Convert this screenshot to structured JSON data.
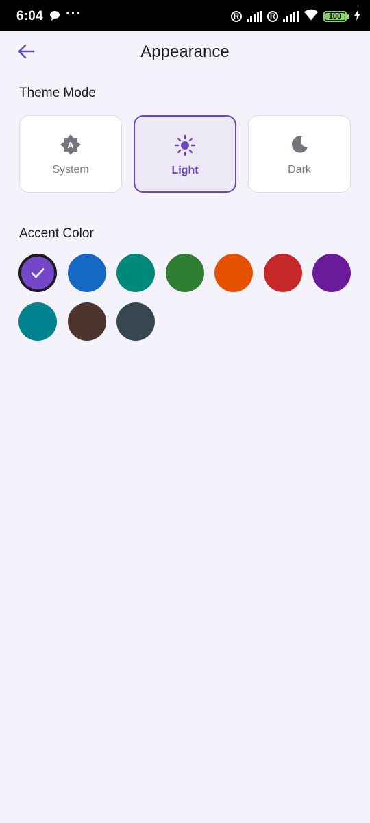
{
  "status_bar": {
    "time": "6:04",
    "dots": "···",
    "reg_symbol": "R",
    "battery": "100"
  },
  "header": {
    "title": "Appearance",
    "back_icon": "arrow-back-icon"
  },
  "theme_mode": {
    "heading": "Theme Mode",
    "options": [
      {
        "label": "System",
        "icon": "brightness-auto-icon",
        "selected": false
      },
      {
        "label": "Light",
        "icon": "sun-icon",
        "selected": true
      },
      {
        "label": "Dark",
        "icon": "moon-icon",
        "selected": false
      }
    ]
  },
  "accent_color": {
    "heading": "Accent Color",
    "selected_index": 0,
    "colors": [
      "#7247c8",
      "#1568c4",
      "#00897b",
      "#2e7d32",
      "#e65100",
      "#c62828",
      "#6a1b9a",
      "#00838f",
      "#4e342e",
      "#37474f"
    ]
  },
  "theme_colors": {
    "primary": "#6a45c0",
    "background": "#f4f3fb",
    "selected_card_bg": "#ede9f6"
  }
}
